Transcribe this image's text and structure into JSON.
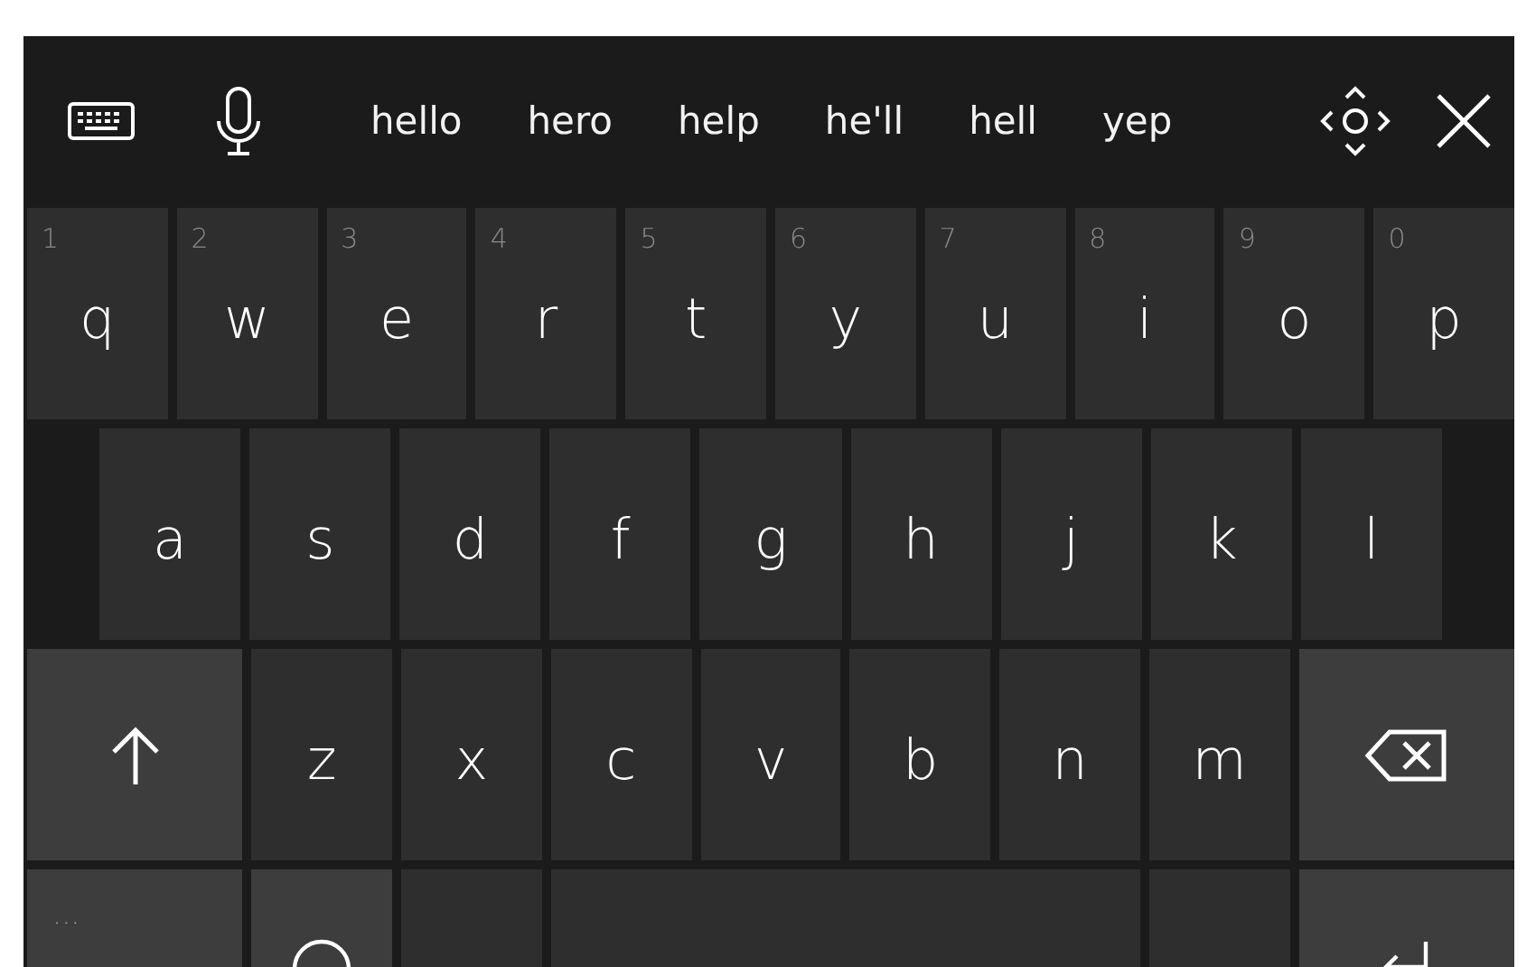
{
  "suggestions": [
    "hello",
    "hero",
    "help",
    "he'll",
    "hell",
    "yep"
  ],
  "rows": [
    {
      "indent": false,
      "keys": [
        {
          "kind": "letter",
          "label": "q",
          "hint": "1"
        },
        {
          "kind": "letter",
          "label": "w",
          "hint": "2"
        },
        {
          "kind": "letter",
          "label": "e",
          "hint": "3"
        },
        {
          "kind": "letter",
          "label": "r",
          "hint": "4"
        },
        {
          "kind": "letter",
          "label": "t",
          "hint": "5"
        },
        {
          "kind": "letter",
          "label": "y",
          "hint": "6"
        },
        {
          "kind": "letter",
          "label": "u",
          "hint": "7"
        },
        {
          "kind": "letter",
          "label": "i",
          "hint": "8"
        },
        {
          "kind": "letter",
          "label": "o",
          "hint": "9"
        },
        {
          "kind": "letter",
          "label": "p",
          "hint": "0"
        }
      ]
    },
    {
      "indent": true,
      "keys": [
        {
          "kind": "letter",
          "label": "a"
        },
        {
          "kind": "letter",
          "label": "s"
        },
        {
          "kind": "letter",
          "label": "d"
        },
        {
          "kind": "letter",
          "label": "f"
        },
        {
          "kind": "letter",
          "label": "g"
        },
        {
          "kind": "letter",
          "label": "h"
        },
        {
          "kind": "letter",
          "label": "j"
        },
        {
          "kind": "letter",
          "label": "k"
        },
        {
          "kind": "letter",
          "label": "l"
        }
      ]
    },
    {
      "indent": false,
      "keys": [
        {
          "kind": "shift"
        },
        {
          "kind": "letter",
          "label": "z"
        },
        {
          "kind": "letter",
          "label": "x"
        },
        {
          "kind": "letter",
          "label": "c"
        },
        {
          "kind": "letter",
          "label": "v"
        },
        {
          "kind": "letter",
          "label": "b"
        },
        {
          "kind": "letter",
          "label": "n"
        },
        {
          "kind": "letter",
          "label": "m"
        },
        {
          "kind": "backspace"
        }
      ]
    },
    {
      "indent": false,
      "keys": [
        {
          "kind": "more",
          "label": "···"
        },
        {
          "kind": "emoji"
        },
        {
          "kind": "blank"
        },
        {
          "kind": "space"
        },
        {
          "kind": "blank"
        },
        {
          "kind": "enter"
        }
      ]
    }
  ]
}
